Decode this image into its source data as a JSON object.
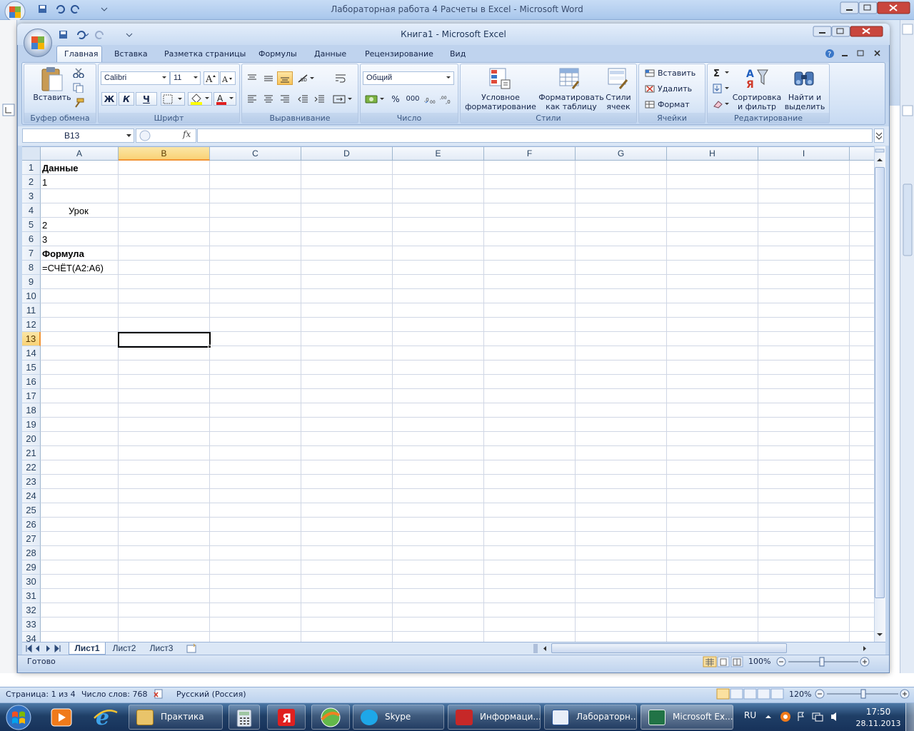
{
  "word": {
    "title": "Лабораторная работа 4 Расчеты в Excel - Microsoft Word",
    "status_page": "Страница: 1 из 4",
    "status_words": "Число слов: 768",
    "status_lang": "Русский (Россия)",
    "zoom": "120%"
  },
  "excel": {
    "title": "Книга1 - Microsoft Excel",
    "tabs": [
      "Главная",
      "Вставка",
      "Разметка страницы",
      "Формулы",
      "Данные",
      "Рецензирование",
      "Вид"
    ],
    "ribbon": {
      "clipboard": {
        "paste": "Вставить",
        "label": "Буфер обмена"
      },
      "font": {
        "name": "Calibri",
        "size": "11",
        "bold": "Ж",
        "italic": "К",
        "underline": "Ч",
        "label": "Шрифт"
      },
      "alignment": {
        "label": "Выравнивание"
      },
      "number": {
        "format": "Общий",
        "percent": "%",
        "thousands": "000",
        "label": "Число"
      },
      "styles": {
        "conditional_1": "Условное",
        "conditional_2": "форматирование",
        "table_1": "Форматировать",
        "table_2": "как таблицу",
        "cell_1": "Стили",
        "cell_2": "ячеек",
        "label": "Стили"
      },
      "cells": {
        "insert": "Вставить",
        "delete": "Удалить",
        "format": "Формат",
        "label": "Ячейки"
      },
      "editing": {
        "sort_1": "Сортировка",
        "sort_2": "и фильтр",
        "find_1": "Найти и",
        "find_2": "выделить",
        "label": "Редактирование"
      }
    },
    "name_box": "B13",
    "fx": "fx",
    "columns": [
      "A",
      "B",
      "C",
      "D",
      "E",
      "F",
      "G",
      "H",
      "I"
    ],
    "selected_column": "B",
    "selected_row": "13",
    "rows": [
      "1",
      "2",
      "3",
      "4",
      "5",
      "6",
      "7",
      "8",
      "9",
      "10",
      "11",
      "12",
      "13",
      "14",
      "15",
      "16",
      "17",
      "18",
      "19",
      "20",
      "21",
      "22",
      "23",
      "24",
      "25",
      "26",
      "27",
      "28",
      "29",
      "30",
      "31",
      "32",
      "33",
      "34"
    ],
    "cells": {
      "A1": "Данные",
      "A2": "1",
      "A4": "Урок",
      "A5": "2",
      "A6": "3",
      "A7": "Формула",
      "A8": "=СЧЁТ(A2:A6)"
    },
    "sheets": [
      "Лист1",
      "Лист2",
      "Лист3"
    ],
    "status": "Готово",
    "zoom": "100%"
  },
  "taskbar": {
    "items": [
      "Практика",
      "Skype",
      "Информаци...",
      "Лабораторн...",
      "Microsoft Ex..."
    ],
    "lang": "RU",
    "time": "17:50",
    "date": "28.11.2013"
  },
  "colors": {
    "selection": "#f9d276",
    "taskbar": "#1f3f67",
    "ribbon": "#d4e3f6"
  }
}
